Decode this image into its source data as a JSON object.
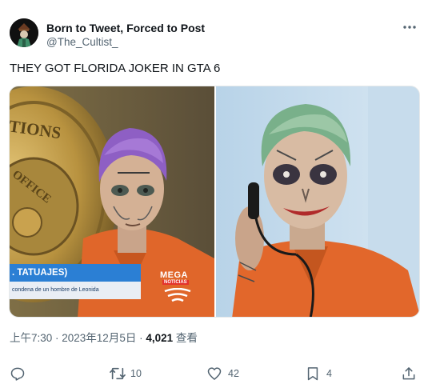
{
  "author": {
    "display_name": "Born to Tweet, Forced to Post",
    "handle": "@The_Cultist_"
  },
  "tweet": {
    "text": "THEY GOT FLORIDA JOKER IN GTA 6"
  },
  "media": {
    "left_image": {
      "badge_text": "TIONS",
      "badge_text_2": "OFFICE",
      "chyron_title": ". TATUAJES)",
      "chyron_subtitle": "condena de un hombre de Leonida",
      "channel_logo": "MEGA",
      "channel_logo_sub": "NOTICIAS"
    }
  },
  "meta": {
    "timestamp": "上午7:30 · 2023年12月5日 · ",
    "views_count": "4,021",
    "views_label": " 查看"
  },
  "actions": {
    "reply": {
      "icon": "reply-icon",
      "count": ""
    },
    "retweet": {
      "icon": "retweet-icon",
      "count": "10"
    },
    "like": {
      "icon": "heart-icon",
      "count": "42"
    },
    "bookmark": {
      "icon": "bookmark-icon",
      "count": "4"
    },
    "share": {
      "icon": "share-icon",
      "count": ""
    }
  },
  "colors": {
    "text_primary": "#0f1419",
    "text_secondary": "#536471",
    "chyron_blue": "#2b7fd4",
    "jumpsuit_orange": "#e0662a"
  }
}
